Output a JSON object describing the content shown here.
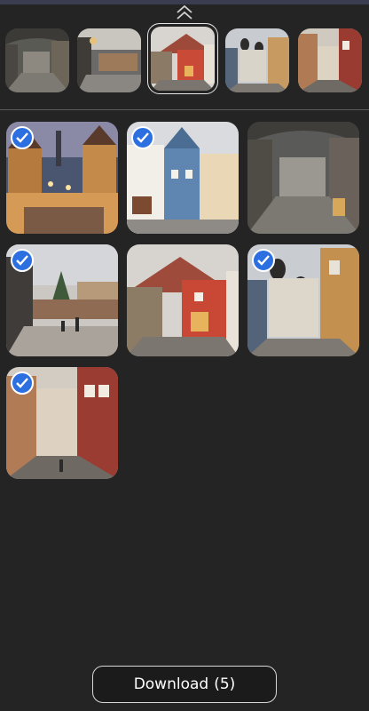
{
  "header": {
    "collapse_icon": "double-chevron-up-icon"
  },
  "strip": {
    "thumbnails": [
      {
        "name": "archway-alley",
        "selected": false
      },
      {
        "name": "street-lamp-market",
        "selected": false
      },
      {
        "name": "red-house",
        "selected": true
      },
      {
        "name": "cathedral-street",
        "selected": false
      },
      {
        "name": "narrow-street",
        "selected": false
      }
    ]
  },
  "grid": {
    "items": [
      {
        "name": "night-towers",
        "checked": true
      },
      {
        "name": "blue-house",
        "checked": true
      },
      {
        "name": "arched-alley",
        "checked": false
      },
      {
        "name": "christmas-market",
        "checked": true
      },
      {
        "name": "red-house",
        "checked": false
      },
      {
        "name": "onion-domes",
        "checked": true
      },
      {
        "name": "old-street",
        "checked": true
      }
    ],
    "check_icon": "checkmark-icon"
  },
  "download": {
    "label": "Download",
    "count": "(5)"
  },
  "colors": {
    "accent": "#2b6fe0",
    "background": "#242424"
  }
}
